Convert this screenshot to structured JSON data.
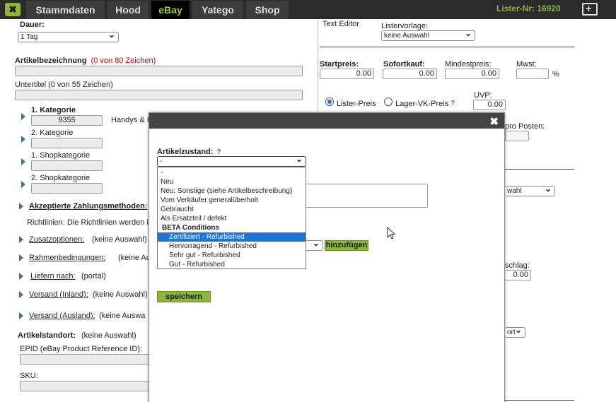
{
  "topbar": {
    "tabs": [
      "Stammdaten",
      "Hood",
      "eBay",
      "Yatego",
      "Shop"
    ],
    "lister_nr": "Lister-Nr: 16920"
  },
  "left": {
    "dauer_label": "Dauer:",
    "dauer_value": "1 Tag",
    "artikelbezeichnung_label": "Artikelbezeichnung",
    "artikelbezeichnung_count": "(0 von 80 Zeichen)",
    "untertitel_label": "Untertitel (0 von 55 Zeichen)",
    "kat1_label": "1. Kategorie",
    "kat1_value": "9355",
    "kat1_name": "Handys & I",
    "kat2_label": "2. Kategorie",
    "shopkat1_label": "1. Shopkategorie",
    "shopkat2_label": "2. Shopkategorie",
    "zahlung_label": "Akzeptierte Zahlungsmethoden:",
    "richtlinien_text": "Richtlinien: Die Richtlinien werden i",
    "zusatzoptionen_label": "Zusatzoptionen:",
    "zusatzoptionen_value": "(keine Auswahl)",
    "rahmen_label": "Rahmenbedingungen:",
    "rahmen_value": "(keine Au",
    "liefern_label": "Liefern nach:",
    "liefern_value": "(portal)",
    "versand_inland_label": "Versand (Inland):",
    "versand_inland_value": "(keine Auswahl)",
    "versand_ausland_label": "Versand (Ausland):",
    "versand_ausland_value": "(keine Auswa",
    "artikelstandort_label": "Artikelstandort:",
    "artikelstandort_value": "(keine Auswahl)",
    "epid_label": "EPID (eBay Product Reference ID):",
    "sku_label": "SKU:"
  },
  "right": {
    "text_editor": "Text Editor",
    "listervorlage_label": "Listervorlage:",
    "listervorlage_value": "keine Auswahl",
    "startpreis_label": "Startpreis:",
    "startpreis_value": "0.00",
    "sofortkauf_label": "Sofortkauf:",
    "sofortkauf_value": "0.00",
    "mindestpreis_label": "Mindestpreis:",
    "mindestpreis_value": "0.00",
    "mwst_label": "Mwst:",
    "percent": "%",
    "lister_preis": "Lister-Preis",
    "lager_vk_preis": "Lager-VK-Preis",
    "uvp_label": "UVP:",
    "uvp_value": "0.00",
    "pro_posten": "pro Posten:",
    "select_partial": "wahl",
    "schlag_label": "schlag:",
    "schlag_value": "0.00",
    "ort_partial": "ort"
  },
  "modal": {
    "zustand_label": "Artikelzustand:",
    "help": "?",
    "zustand_value": "-",
    "hinzufuegen": "hinzufügen",
    "speichern": "speichern",
    "options": [
      "-",
      "Neu",
      "Neu: Sonstige (siehe Artikelbeschreibung)",
      "Vom Verkäufer generalüberholt",
      "Gebraucht",
      "Als Ersatzteil / defekt",
      "BETA Conditions",
      "Zertifiziert - Refurbished",
      "Hervorragend - Refurbished",
      "Sehr gut - Refurbished",
      "Gut - Refurbished"
    ]
  },
  "colors": {
    "accent": "#8bb83a",
    "highlight": "#1e73d6",
    "topbar": "#2b2b2b"
  }
}
